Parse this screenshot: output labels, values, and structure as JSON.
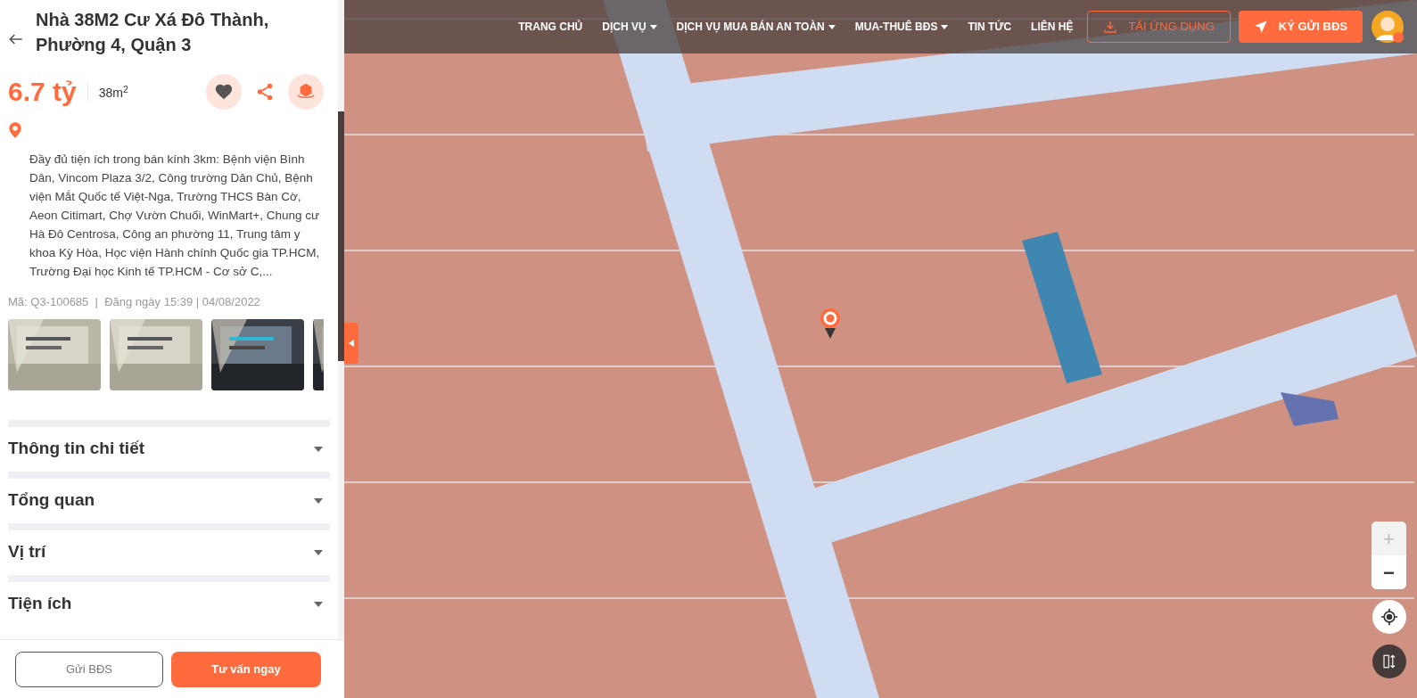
{
  "listing": {
    "title": "Nhà 38M2 Cư Xá Đô Thành, Phường 4, Quận 3",
    "price": "6.7 tỷ",
    "area": "38m$^{2}$",
    "favorite": false,
    "description": "Đầy đủ tiện ích trong bán kính 3km: Bệnh viện Bình Dân, Vincom Plaza 3/2, Công trường Dân Chủ, Bệnh viện Mắt Quốc tế Việt-Nga, Trường THCS Bàn Cờ, Aeon Citimart, Chợ Vườn Chuối, WinMart+, Chung cư Hà Đô Centrosa, Công an phường 11, Trung tâm y khoa Kỳ Hòa, Học viện Hành chính Quốc gia TP.HCM, Trường Đại học Kinh tế TP.HCM - Cơ sở C,...",
    "meta": "Mã: Q3-100685  |  Đăng ngày 15:39 | 04/08/2022"
  },
  "sections": [
    {
      "label": "Thông tin chi tiết",
      "expanded": false
    },
    {
      "label": "Tổng quan",
      "expanded": false
    },
    {
      "label": "Vị trí",
      "expanded": false
    },
    {
      "label": "Tiện ích",
      "expanded": false
    }
  ],
  "footer_buttons": [
    {
      "label": "Gửi BĐS",
      "kind": "outline"
    },
    {
      "label": "Tư vấn ngay",
      "kind": "primary"
    }
  ],
  "nav": [
    {
      "label": "TRANG CHỦ",
      "has_menu": false
    },
    {
      "label": "DỊCH VỤ",
      "has_menu": true
    },
    {
      "label": "DỊCH VỤ MUA BÁN AN TOÀN",
      "has_menu": true
    },
    {
      "label": "MUA-THUÊ BĐS",
      "has_menu": true
    },
    {
      "label": "TIN TỨC",
      "has_menu": false
    },
    {
      "label": "LIÊN HỆ",
      "has_menu": false
    }
  ],
  "header_buttons": [
    {
      "label": "TẢI ỨNG DỤNG",
      "kind": "outline"
    },
    {
      "label": "KÝ GỬI BĐS",
      "kind": "primary"
    }
  ],
  "map_controls": {
    "zoom_in": {
      "label": "+",
      "disabled": true
    },
    "zoom_out": {
      "label": "−",
      "disabled": false
    }
  }
}
